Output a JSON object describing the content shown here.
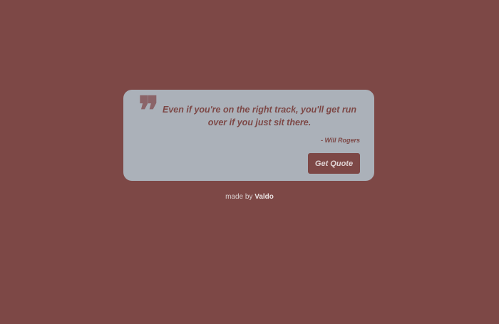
{
  "quote": {
    "text": "Even if you're on the right track, you'll get run over if you just sit there.",
    "author": "- Will Rogers",
    "icon": "quote-icon",
    "icon_glyph": "❞"
  },
  "button": {
    "label": "Get Quote"
  },
  "credit": {
    "prefix": "made by",
    "name": "Valdo"
  },
  "colors": {
    "background": "#7d4846",
    "card": "#abb1b9"
  }
}
